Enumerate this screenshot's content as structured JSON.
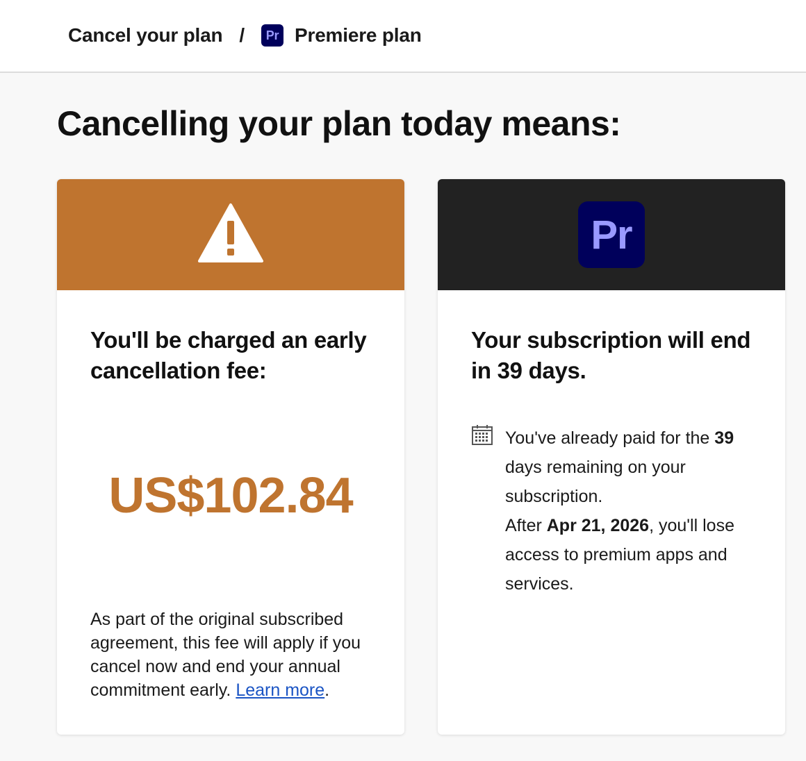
{
  "breadcrumb": {
    "items": [
      "Cancel your plan",
      "Premiere plan"
    ],
    "separator": "/",
    "plan_icon_text": "Pr"
  },
  "page": {
    "title": "Cancelling your plan today means:"
  },
  "fee_card": {
    "banner_color": "#bf742f",
    "banner_icon": "warning-icon",
    "heading": "You'll be charged an early cancellation fee:",
    "amount": "US$102.84",
    "note": "As part of the original subscribed agreement, this fee will apply if you cancel now and end your annual commitment early.",
    "link_label": "Learn more",
    "link_suffix": "."
  },
  "subscription_card": {
    "banner_color": "#222222",
    "app_icon_text": "Pr",
    "app_icon_bg": "#00005b",
    "app_icon_fg": "#9999ff",
    "heading": "Your subscription will end in 39 days.",
    "info_icon": "calendar-icon",
    "paid_prefix": "You've already paid for the ",
    "paid_days": "39",
    "paid_suffix": " days remaining on your subscription.",
    "after_prefix": "After ",
    "end_date": "Apr 21, 2026",
    "after_suffix": ", you'll lose access to premium apps and services."
  }
}
